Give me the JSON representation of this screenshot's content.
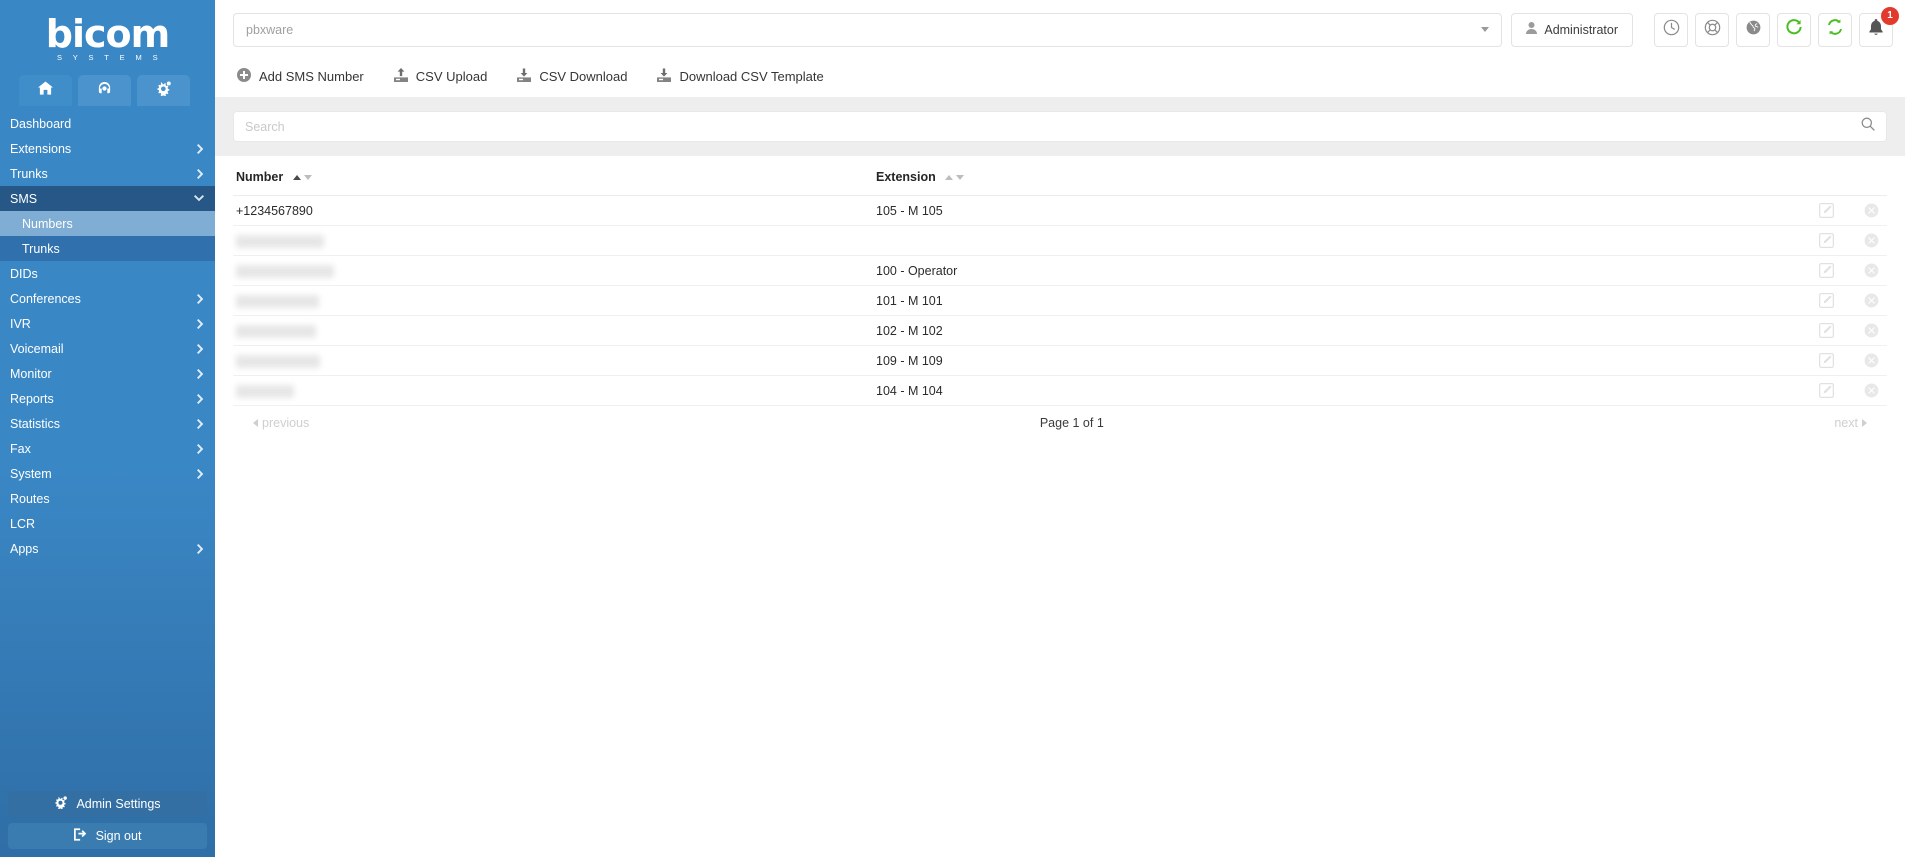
{
  "brand": {
    "name": "bicom",
    "tagline": "S Y S T E M S"
  },
  "sidebar": {
    "tabs": [
      {
        "name": "home-tab",
        "icon": "home-icon",
        "active": true
      },
      {
        "name": "support-tab",
        "icon": "headset-icon",
        "active": false
      },
      {
        "name": "settings-tab",
        "icon": "gears-icon",
        "active": false
      }
    ],
    "items": [
      {
        "label": "Dashboard",
        "expandable": false,
        "state": "normal"
      },
      {
        "label": "Extensions",
        "expandable": true,
        "state": "normal"
      },
      {
        "label": "Trunks",
        "expandable": true,
        "state": "normal"
      },
      {
        "label": "SMS",
        "expandable": true,
        "state": "open"
      },
      {
        "label": "Numbers",
        "expandable": false,
        "state": "child-active"
      },
      {
        "label": "Trunks",
        "expandable": false,
        "state": "child"
      },
      {
        "label": "DIDs",
        "expandable": false,
        "state": "normal"
      },
      {
        "label": "Conferences",
        "expandable": true,
        "state": "normal"
      },
      {
        "label": "IVR",
        "expandable": true,
        "state": "normal"
      },
      {
        "label": "Voicemail",
        "expandable": true,
        "state": "normal"
      },
      {
        "label": "Monitor",
        "expandable": true,
        "state": "normal"
      },
      {
        "label": "Reports",
        "expandable": true,
        "state": "normal"
      },
      {
        "label": "Statistics",
        "expandable": true,
        "state": "normal"
      },
      {
        "label": "Fax",
        "expandable": true,
        "state": "normal"
      },
      {
        "label": "System",
        "expandable": true,
        "state": "normal"
      },
      {
        "label": "Routes",
        "expandable": false,
        "state": "normal"
      },
      {
        "label": "LCR",
        "expandable": false,
        "state": "normal"
      },
      {
        "label": "Apps",
        "expandable": true,
        "state": "normal"
      }
    ],
    "admin_settings_label": "Admin Settings",
    "sign_out_label": "Sign out"
  },
  "topbar": {
    "server_select_value": "pbxware",
    "user_label": "Administrator",
    "icons": [
      {
        "name": "clock-icon",
        "color": "#8a8a8a"
      },
      {
        "name": "lifebuoy-icon",
        "color": "#8a8a8a"
      },
      {
        "name": "globe-icon",
        "color": "#8a8a8a"
      },
      {
        "name": "reload-icon",
        "color": "#4bbd20"
      },
      {
        "name": "sync-icon",
        "color": "#4bbd20"
      },
      {
        "name": "bell-icon",
        "color": "#555555"
      }
    ],
    "notification_count": "1"
  },
  "actions": [
    {
      "label": "Add SMS Number",
      "icon": "plus-circle-icon"
    },
    {
      "label": "CSV Upload",
      "icon": "upload-icon"
    },
    {
      "label": "CSV Download",
      "icon": "download-icon"
    },
    {
      "label": "Download CSV Template",
      "icon": "download-icon"
    }
  ],
  "search": {
    "placeholder": "Search",
    "value": "",
    "icon": "search-icon"
  },
  "table": {
    "columns": [
      {
        "label": "Number",
        "sort": "asc"
      },
      {
        "label": "Extension",
        "sort": "none"
      }
    ],
    "rows": [
      {
        "number": "+1234567890",
        "redacted": false,
        "redact_width": 0,
        "extension": "105 - M 105"
      },
      {
        "number": "",
        "redacted": true,
        "redact_width": 88,
        "extension": ""
      },
      {
        "number": "",
        "redacted": true,
        "redact_width": 98,
        "extension": "100 - Operator"
      },
      {
        "number": "",
        "redacted": true,
        "redact_width": 83,
        "extension": "101 - M 101"
      },
      {
        "number": "",
        "redacted": true,
        "redact_width": 80,
        "extension": "102 - M 102"
      },
      {
        "number": "",
        "redacted": true,
        "redact_width": 84,
        "extension": "109 - M 109"
      },
      {
        "number": "",
        "redacted": true,
        "redact_width": 58,
        "extension": "104 - M 104"
      }
    ],
    "row_actions": [
      {
        "name": "edit-icon",
        "title": "Edit"
      },
      {
        "name": "delete-icon",
        "title": "Delete"
      }
    ]
  },
  "pagination": {
    "previous": "previous",
    "page_info": "Page 1 of 1",
    "next": "next"
  },
  "colors": {
    "sidebar_top": "#3a87c5",
    "sidebar_bottom": "#2f6ea6",
    "group_open": "#265786",
    "child_active": "#7fadd4",
    "accent_green": "#4bbd20",
    "badge_red": "#e23b2e",
    "search_band": "#eeeeee"
  }
}
